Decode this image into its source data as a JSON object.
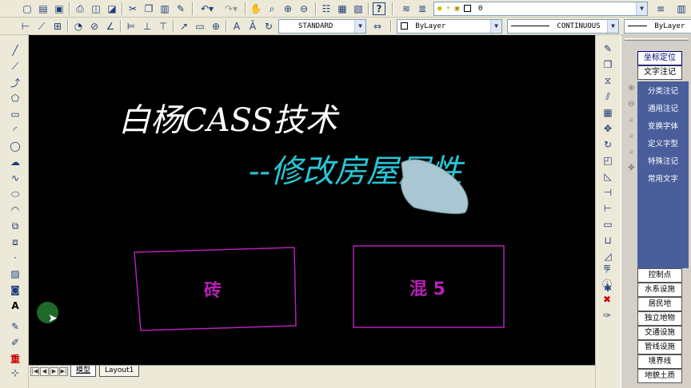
{
  "toolbar": {
    "text_style": "STANDARD",
    "layer_value": "0",
    "color_value": "ByLayer",
    "linetype_value": "CONTINUOUS",
    "lineweight_value": "ByLayer",
    "icons_row1": [
      "new-icon",
      "open-icon",
      "save-icon",
      "print-icon",
      "preview-icon",
      "publish-icon",
      "cut-icon",
      "copy-icon",
      "paste-icon",
      "match-properties-icon",
      "undo-icon",
      "redo-icon",
      "pan-icon",
      "zoom-realtime-icon",
      "zoom-window-icon",
      "zoom-previous-icon",
      "properties-icon",
      "design-center-icon",
      "tool-palettes-icon",
      "help-icon",
      "layer-manager-icon",
      "layer-state-icon",
      "lightbulb-icon",
      "sun-icon",
      "lock-icon",
      "layer-color-icon"
    ],
    "icons_row2": [
      "linear-dim-icon",
      "aligned-dim-icon",
      "ordinate-dim-icon",
      "radius-dim-icon",
      "diameter-dim-icon",
      "angular-dim-icon",
      "quick-dim-icon",
      "baseline-dim-icon",
      "continue-dim-icon",
      "leader-icon",
      "tolerance-icon",
      "center-mark-icon",
      "dim-edit-icon",
      "dim-text-edit-icon",
      "dim-update-icon",
      "dim-style-icon"
    ]
  },
  "draw_tools": [
    "line-icon",
    "construction-line-icon",
    "polyline-icon",
    "polygon-icon",
    "rectangle-icon",
    "arc-icon",
    "circle-icon",
    "revision-cloud-icon",
    "spline-icon",
    "ellipse-icon",
    "ellipse-arc-icon",
    "insert-block-icon",
    "make-block-icon",
    "point-icon",
    "hatch-icon",
    "region-icon",
    "multiline-text-icon",
    "text-style-icon",
    "edit-icon",
    "red-tool-icon",
    "snap-icon"
  ],
  "modify_tools": [
    "erase-icon",
    "copy-object-icon",
    "mirror-icon",
    "offset-icon",
    "array-icon",
    "move-icon",
    "rotate-icon",
    "scale-icon",
    "stretch-icon",
    "trim-icon",
    "extend-icon",
    "break-icon",
    "join-icon",
    "chamfer-icon",
    "fillet-icon",
    "explode-icon",
    "draw-order-icon",
    "layer-icon",
    "info-icon",
    "delete-x-icon",
    "brush-icon"
  ],
  "drawing": {
    "title_main": "白杨CASS技术",
    "title_sub": "--修改房屋属性",
    "building1_label": "砖",
    "building2_label": "混 5"
  },
  "layout_tabs": {
    "model": "模型",
    "layout1": "Layout1",
    "nav": [
      "|◀",
      "◀",
      "▶",
      "▶|"
    ]
  },
  "cass_panel": {
    "top_buttons": [
      "坐标定位",
      "文字注记"
    ],
    "submenu": [
      "分类注记",
      "通用注记",
      "变换字体",
      "定义字型",
      "特殊注记",
      "常用文字"
    ],
    "categories": [
      "控制点",
      "水系设施",
      "居民地",
      "独立地物",
      "交通设施",
      "管线设施",
      "境界线",
      "地貌土质"
    ]
  },
  "colors": {
    "canvas_bg": "#000000",
    "title_main": "#ffffff",
    "title_sub": "#27c6d6",
    "building_outline": "#b620b6",
    "panel_submenu": "#4a5e9c"
  }
}
